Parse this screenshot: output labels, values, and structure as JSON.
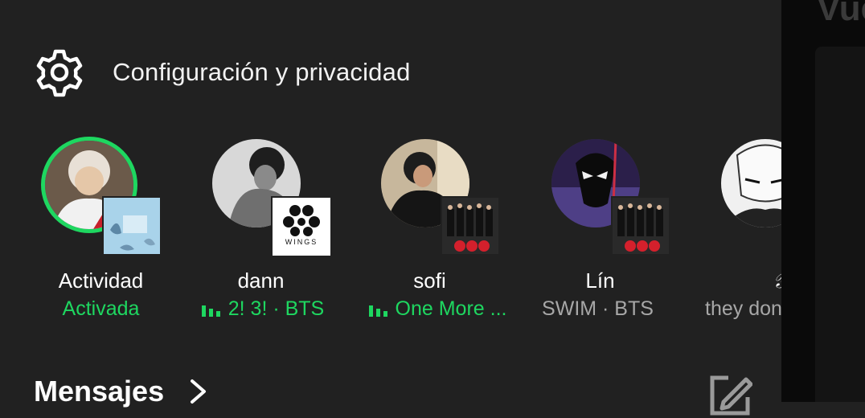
{
  "settings": {
    "label": "Configuración y privacidad",
    "icon": "gear-icon"
  },
  "friends": [
    {
      "name": "Actividad",
      "status": "Activada",
      "status_color": "green",
      "eq": false
    },
    {
      "name": "dann",
      "status": "2! 3! · BTS",
      "status_color": "green",
      "eq": true
    },
    {
      "name": "sofi",
      "status": "One More ...",
      "status_color": "green",
      "eq": true
    },
    {
      "name": "Lín",
      "status": "SWIM · BTS",
      "status_color": "grey",
      "eq": false
    },
    {
      "name": "𝒴𝒮",
      "status": "they don",
      "status_color": "grey",
      "eq": false
    }
  ],
  "covers": {
    "wings_text": "WINGS"
  },
  "right_panel": {
    "title": "Vue"
  },
  "messages": {
    "title": "Mensajes"
  },
  "colors": {
    "accent": "#1ed760",
    "background": "#212121",
    "muted": "#a7a7a7"
  }
}
